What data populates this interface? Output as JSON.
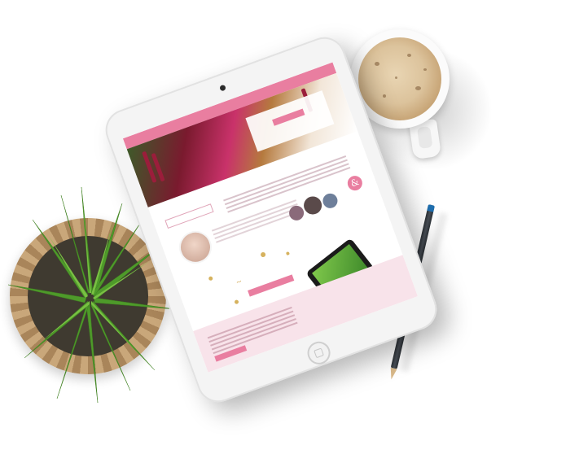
{
  "scene": {
    "objects": [
      "tablet",
      "coffee-cup",
      "pencil",
      "potted-plant"
    ]
  },
  "tablet": {
    "site": {
      "hero_title": "",
      "tagline_text": ""
    }
  },
  "colors": {
    "accent_pink": "#e97ea0",
    "gold": "#d6b25e",
    "background": "#ffffff"
  }
}
